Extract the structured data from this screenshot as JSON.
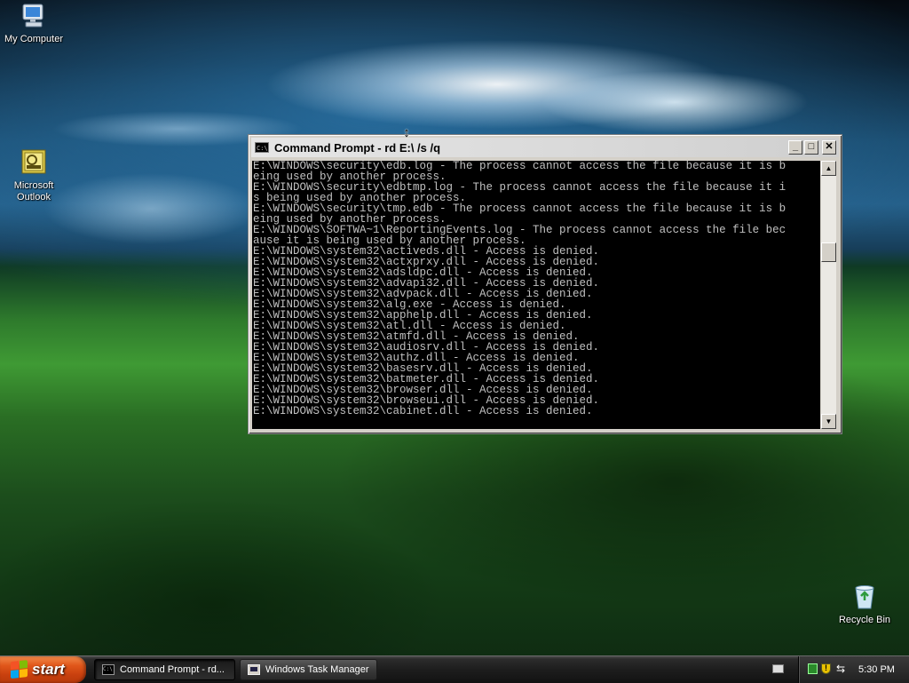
{
  "desktop": {
    "icons": [
      {
        "label": "My Computer",
        "icon": "my-computer-icon"
      },
      {
        "label": "Microsoft\nOutlook",
        "icon": "outlook-icon"
      },
      {
        "label": "Recycle Bin",
        "icon": "recycle-bin-icon"
      }
    ]
  },
  "window": {
    "title": "Command Prompt - rd E:\\ /s /q",
    "icon_text": "C:\\",
    "buttons": {
      "minimize": "_",
      "maximize": "□",
      "close": "✕"
    },
    "console_lines": [
      "E:\\WINDOWS\\security\\edb.log - The process cannot access the file because it is b",
      "eing used by another process.",
      "E:\\WINDOWS\\security\\edbtmp.log - The process cannot access the file because it i",
      "s being used by another process.",
      "E:\\WINDOWS\\security\\tmp.edb - The process cannot access the file because it is b",
      "eing used by another process.",
      "E:\\WINDOWS\\SOFTWA~1\\ReportingEvents.log - The process cannot access the file bec",
      "ause it is being used by another process.",
      "E:\\WINDOWS\\system32\\activeds.dll - Access is denied.",
      "E:\\WINDOWS\\system32\\actxprxy.dll - Access is denied.",
      "E:\\WINDOWS\\system32\\adsldpc.dll - Access is denied.",
      "E:\\WINDOWS\\system32\\advapi32.dll - Access is denied.",
      "E:\\WINDOWS\\system32\\advpack.dll - Access is denied.",
      "E:\\WINDOWS\\system32\\alg.exe - Access is denied.",
      "E:\\WINDOWS\\system32\\apphelp.dll - Access is denied.",
      "E:\\WINDOWS\\system32\\atl.dll - Access is denied.",
      "E:\\WINDOWS\\system32\\atmfd.dll - Access is denied.",
      "E:\\WINDOWS\\system32\\audiosrv.dll - Access is denied.",
      "E:\\WINDOWS\\system32\\authz.dll - Access is denied.",
      "E:\\WINDOWS\\system32\\basesrv.dll - Access is denied.",
      "E:\\WINDOWS\\system32\\batmeter.dll - Access is denied.",
      "E:\\WINDOWS\\system32\\browser.dll - Access is denied.",
      "E:\\WINDOWS\\system32\\browseui.dll - Access is denied.",
      "E:\\WINDOWS\\system32\\cabinet.dll - Access is denied."
    ],
    "scrollbar": {
      "up": "▲",
      "down": "▼"
    }
  },
  "taskbar": {
    "start_label": "start",
    "tasks": [
      {
        "label": "Command Prompt - rd...",
        "icon_text": "C:\\"
      },
      {
        "label": "Windows Task Manager"
      }
    ],
    "clock": "5:30 PM"
  },
  "colors": {
    "console_bg": "#000000",
    "console_text": "#c0c0c0",
    "start_button": "#e0561a",
    "taskbar": "#1d1d1d"
  }
}
